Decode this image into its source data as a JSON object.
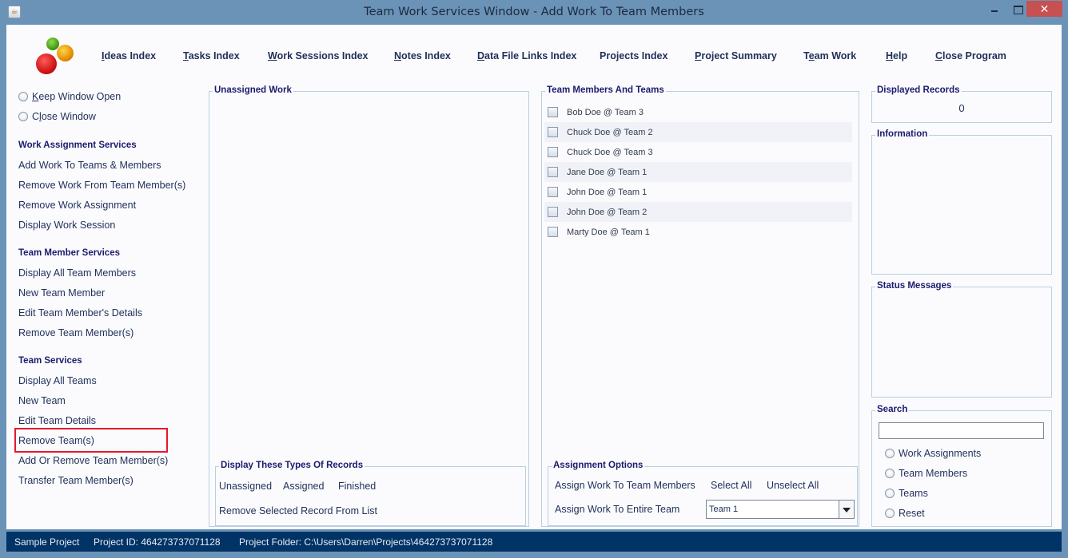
{
  "window": {
    "title": "Team Work Services Window - Add Work To Team Members",
    "app_icon": "java-cup-icon",
    "controls": {
      "minimize": "minimize-icon",
      "maximize": "maximize-icon",
      "close": "✕"
    }
  },
  "logo": {
    "icon": "colored-balls-logo"
  },
  "nav": [
    {
      "mnemonic": "I",
      "rest": "deas Index"
    },
    {
      "mnemonic": "T",
      "rest": "asks Index"
    },
    {
      "mnemonic": "W",
      "rest": "ork Sessions Index"
    },
    {
      "mnemonic": "N",
      "rest": "otes Index"
    },
    {
      "mnemonic": "D",
      "rest": "ata File Links Index"
    },
    {
      "mnemonic": "",
      "rest": "Projects Index"
    },
    {
      "mnemonic": "P",
      "rest": "roject Summary"
    },
    {
      "pre": "T",
      "mnemonic": "e",
      "rest": "am Work"
    },
    {
      "mnemonic": "H",
      "rest": "elp"
    },
    {
      "mnemonic": "C",
      "rest": "lose Program"
    }
  ],
  "sidebar": {
    "window_options": [
      {
        "mnemonic": "K",
        "rest": "eep Window Open"
      },
      {
        "pre": "C",
        "mnemonic": "l",
        "rest": "ose Window"
      }
    ],
    "sections": [
      {
        "heading": "Work Assignment Services",
        "items": [
          "Add Work To Teams & Members",
          "Remove Work From Team Member(s)",
          "Remove Work Assignment",
          "Display Work Session"
        ]
      },
      {
        "heading": "Team Member Services",
        "items": [
          "Display All Team Members",
          "New Team Member",
          "Edit Team Member's Details",
          "Remove Team Member(s)"
        ]
      },
      {
        "heading": "Team Services",
        "items": [
          "Display All Teams",
          "New Team",
          "Edit Team Details",
          "Remove Team(s)",
          "Add Or Remove Team Member(s)",
          "Transfer Team Member(s)"
        ]
      }
    ],
    "highlighted_item": "Remove Team(s)"
  },
  "unassigned_work": {
    "legend": "Unassigned Work",
    "items": []
  },
  "display_types": {
    "legend": "Display These Types Of Records",
    "options": [
      "Unassigned",
      "Assigned",
      "Finished"
    ],
    "remove_label": "Remove Selected Record From List"
  },
  "team_members": {
    "legend": "Team Members And Teams",
    "items": [
      {
        "label": "Bob Doe @ Team 3",
        "checked": false
      },
      {
        "label": "Chuck Doe @ Team 2",
        "checked": false
      },
      {
        "label": "Chuck Doe @ Team 3",
        "checked": false
      },
      {
        "label": "Jane Doe @ Team 1",
        "checked": false
      },
      {
        "label": "John Doe @ Team 1",
        "checked": false
      },
      {
        "label": "John Doe @ Team 2",
        "checked": false
      },
      {
        "label": "Marty Doe @ Team 1",
        "checked": false
      }
    ]
  },
  "assignment_options": {
    "legend": "Assignment Options",
    "assign_members": "Assign Work To Team Members",
    "select_all": "Select All",
    "unselect_all": "Unselect All",
    "assign_team": "Assign Work To Entire Team",
    "team_select_value": "Team 1"
  },
  "displayed_records": {
    "legend": "Displayed Records",
    "count": "0"
  },
  "information": {
    "legend": "Information"
  },
  "status_messages": {
    "legend": "Status Messages"
  },
  "search": {
    "legend": "Search",
    "value": "",
    "placeholder": "",
    "options": [
      "Work Assignments",
      "Team Members",
      "Teams",
      "Reset"
    ]
  },
  "statusbar": {
    "project_name": "Sample Project",
    "project_id": "Project ID:  464273737071128",
    "project_folder": "Project Folder: C:\\Users\\Darren\\Projects\\464273737071128"
  },
  "colors": {
    "titlebar": "#6b93b8",
    "close_button": "#c75050",
    "statusbar": "#003366",
    "highlight_box": "#e21a2c",
    "heading_text": "#1b1b6e",
    "groupbox_border": "#b8cfe0"
  }
}
